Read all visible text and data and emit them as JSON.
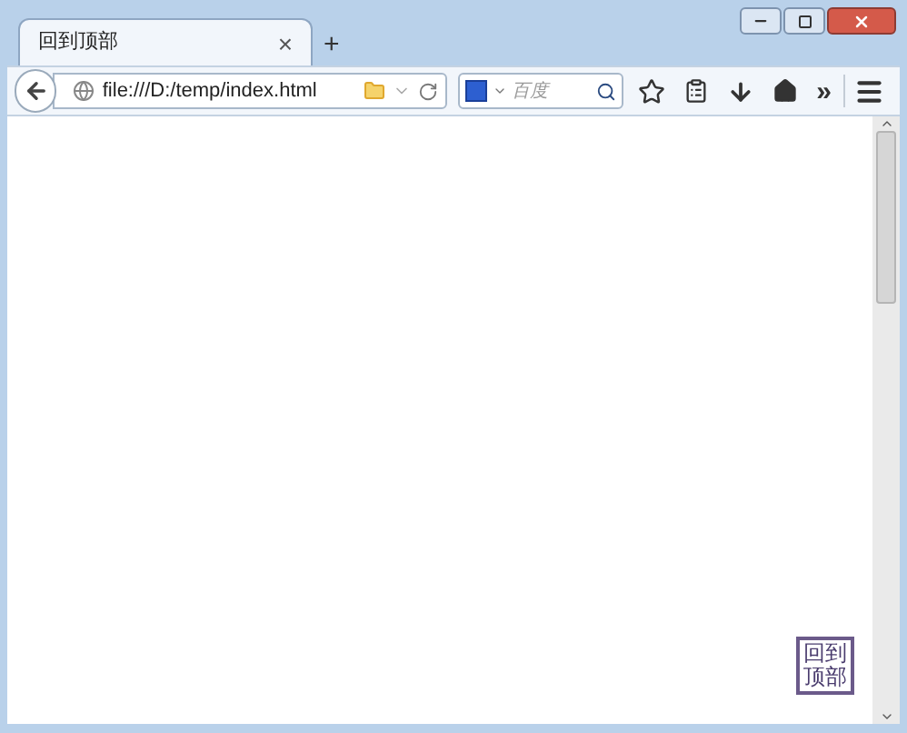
{
  "tab": {
    "title": "回到顶部",
    "close": "×"
  },
  "new_tab": "+",
  "address": {
    "value": "file:///D:/temp/index.html"
  },
  "search": {
    "placeholder": "百度"
  },
  "toolbar_more": "»",
  "page": {
    "back_to_top": "回到顶部"
  }
}
